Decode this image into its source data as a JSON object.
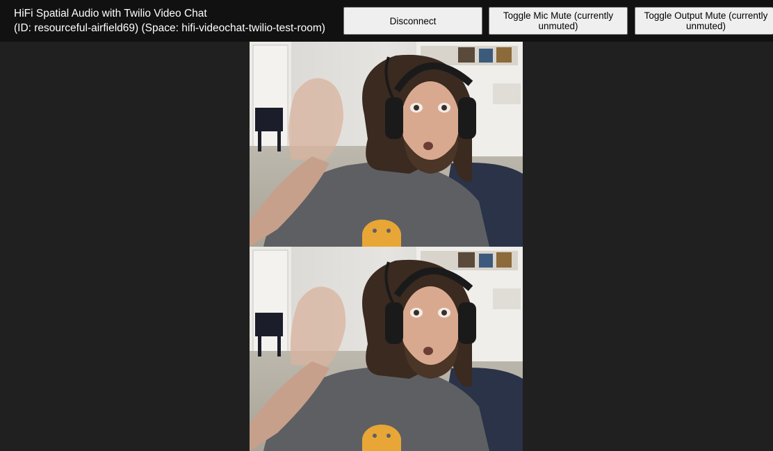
{
  "app": {
    "title_line1": "HiFi Spatial Audio with Twilio Video Chat",
    "title_line2": "(ID: resourceful-airfield69) (Space: hifi-videochat-twilio-test-room)"
  },
  "controls": {
    "disconnect_label": "Disconnect",
    "mic_mute_label": "Toggle Mic Mute (currently unmuted)",
    "output_mute_label": "Toggle Output Mute (currently unmuted)"
  },
  "video_feeds": [
    {
      "kind": "local-participant-video"
    },
    {
      "kind": "remote-participant-video"
    }
  ],
  "colors": {
    "topbar": "#111111",
    "background": "#202020",
    "button": "#efefef"
  }
}
